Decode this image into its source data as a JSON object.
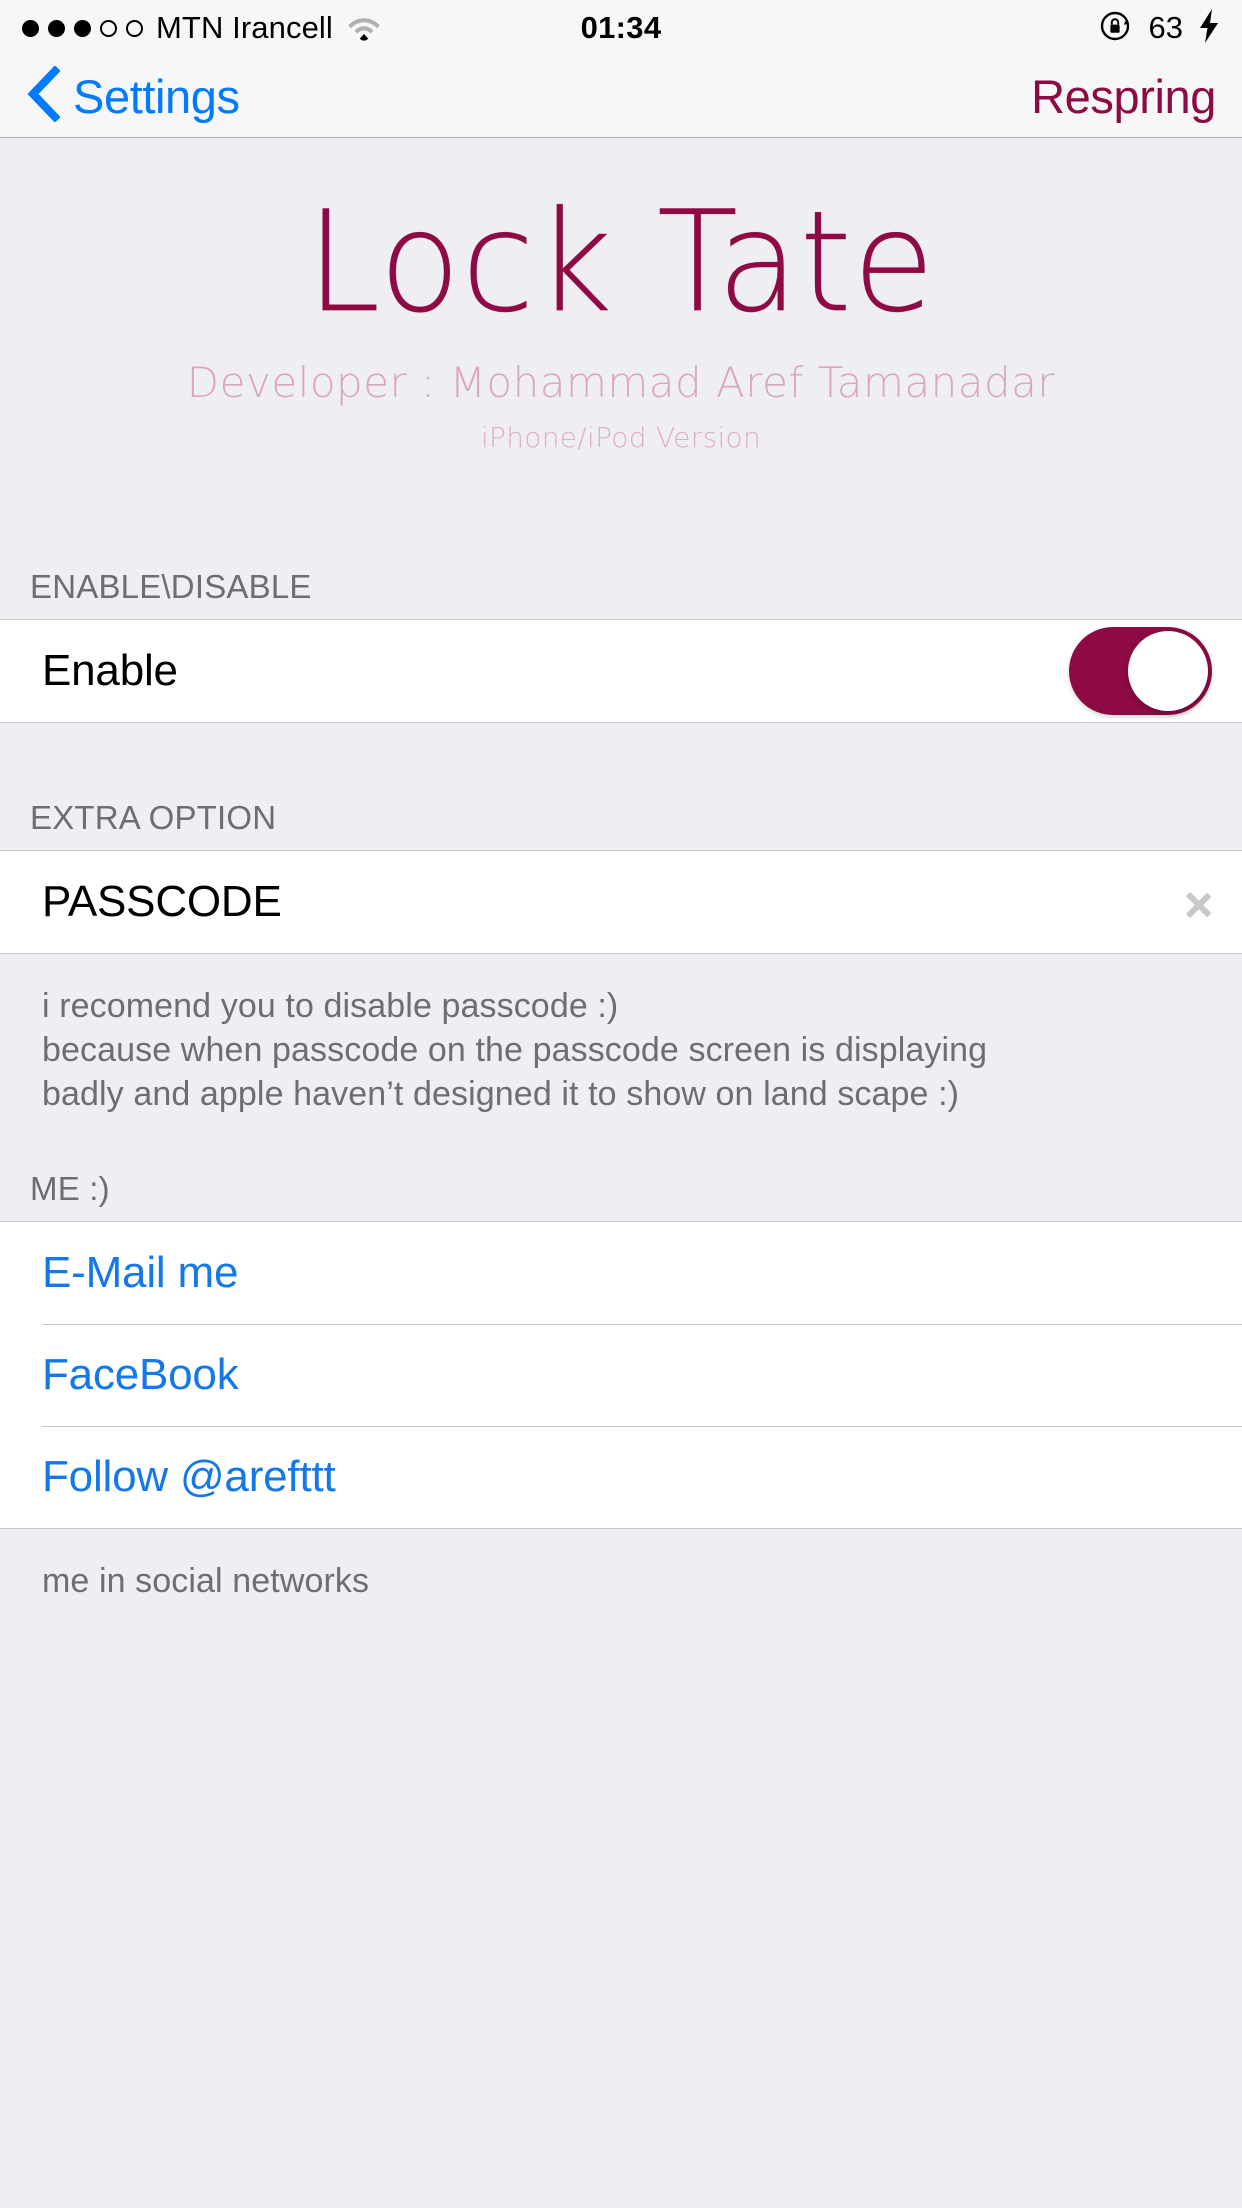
{
  "statusbar": {
    "signal_dots_filled": 3,
    "signal_dots_empty": 2,
    "carrier": "MTN Irancell",
    "wifi_icon": "wifi-icon",
    "time": "01:34",
    "rotation_lock_icon": "rotation-lock-icon",
    "battery_percent": "63",
    "charging_icon": "lightning-bolt-icon"
  },
  "navbar": {
    "back_icon": "chevron-left-icon",
    "back_label": "Settings",
    "action_label": "Respring",
    "back_color": "#007AFF",
    "action_color": "#8E0A45"
  },
  "hero": {
    "title": "Lock Tate",
    "developer": "Developer : Mohammad Aref Tamanadar",
    "version": "iPhone/iPod Version",
    "title_color": "#8E0A45",
    "subtitle_color": "#D9A8BE"
  },
  "sections": [
    {
      "header": "ENABLE\\DISABLE",
      "rows": [
        {
          "label": "Enable",
          "control": "switch",
          "switch_on": true
        }
      ],
      "footer": null
    },
    {
      "header": "EXTRA OPTION",
      "rows": [
        {
          "label": "PASSCODE",
          "control": "disclosure"
        }
      ],
      "footer": [
        "i recomend you to disable passcode :)",
        "because when passcode on the passcode screen is displaying",
        "badly and apple haven’t designed it to show on land scape :)"
      ]
    },
    {
      "header": "ME :)",
      "rows": [
        {
          "label": "E-Mail me",
          "control": "link"
        },
        {
          "label": "FaceBook",
          "control": "link"
        },
        {
          "label": "Follow @arefttt",
          "control": "link"
        }
      ],
      "footer": [
        "me in social networks"
      ]
    }
  ],
  "colors": {
    "accent": "#8E0A45",
    "link": "#1478E8",
    "group_background": "#EFEEF3",
    "cell_background": "#FFFFFF",
    "separator": "#C8C7CC",
    "secondary_text": "#6D6D72"
  }
}
